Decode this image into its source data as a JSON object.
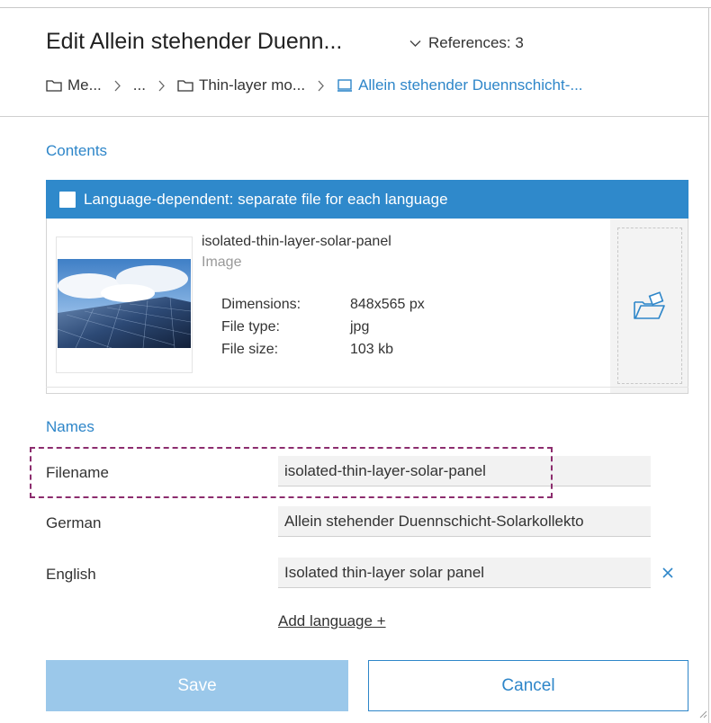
{
  "header": {
    "title": "Edit Allein stehender Duenn...",
    "references_label": "References: 3"
  },
  "breadcrumb": [
    {
      "label": "Me...",
      "icon": "folder-icon"
    },
    {
      "label": "...",
      "icon": ""
    },
    {
      "label": "Thin-layer mo...",
      "icon": "folder-icon"
    },
    {
      "label": "Allein stehender Duennschicht-...",
      "icon": "media-item-icon",
      "active": true
    }
  ],
  "contents": {
    "section_label": "Contents",
    "language_dependent_label": "Language-dependent: separate file for each language",
    "language_dependent_checked": false,
    "media": {
      "name": "isolated-thin-layer-solar-panel",
      "type": "Image",
      "properties": [
        {
          "key": "Dimensions:",
          "value": "848x565 px"
        },
        {
          "key": "File type:",
          "value": "jpg"
        },
        {
          "key": "File size:",
          "value": "103 kb"
        }
      ]
    },
    "upload_icon": "folder-open-upload-icon"
  },
  "names": {
    "section_label": "Names",
    "filename": {
      "label": "Filename",
      "value": "isolated-thin-layer-solar-panel"
    },
    "german": {
      "label": "German",
      "value": "Allein stehender Duennschicht-Solarkollekto"
    },
    "english": {
      "label": "English",
      "value": "Isolated thin-layer solar panel"
    },
    "add_language": "Add language +"
  },
  "actions": {
    "save": "Save",
    "cancel": "Cancel"
  },
  "colors": {
    "accent": "#2e86c9",
    "save_disabled": "#9bc8ea",
    "highlight": "#8c2d6e"
  }
}
